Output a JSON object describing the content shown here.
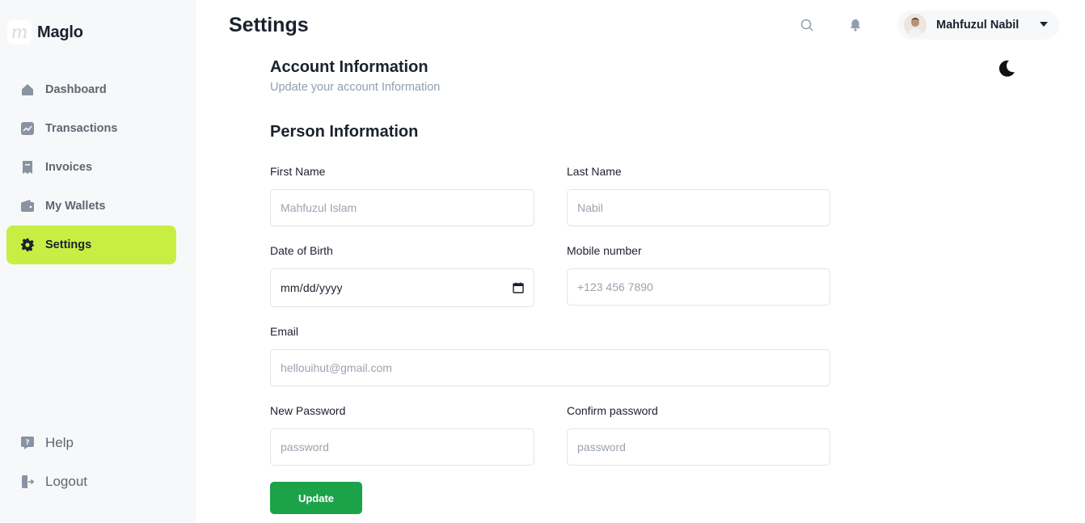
{
  "brand": {
    "logo_letter": "m",
    "name": "Maglo"
  },
  "sidebar": {
    "items": [
      {
        "label": "Dashboard",
        "icon": "home-icon"
      },
      {
        "label": "Transactions",
        "icon": "chart-icon"
      },
      {
        "label": "Invoices",
        "icon": "receipt-icon"
      },
      {
        "label": "My Wallets",
        "icon": "wallet-icon"
      },
      {
        "label": "Settings",
        "icon": "gear-icon",
        "active": true
      }
    ],
    "bottom": [
      {
        "label": "Help",
        "icon": "help-icon"
      },
      {
        "label": "Logout",
        "icon": "logout-icon"
      }
    ]
  },
  "header": {
    "title": "Settings",
    "user_name": "Mahfuzul Nabil"
  },
  "account": {
    "title": "Account Information",
    "subtitle": "Update your account Information"
  },
  "person": {
    "title": "Person Information",
    "first_name": {
      "label": "First Name",
      "placeholder": "Mahfuzul Islam"
    },
    "last_name": {
      "label": "Last Name",
      "placeholder": "Nabil"
    },
    "dob": {
      "label": "Date of Birth",
      "placeholder": "mm/dd/yyyy"
    },
    "mobile": {
      "label": "Mobile number",
      "placeholder": "+123 456 7890"
    },
    "email": {
      "label": "Email",
      "placeholder": "hellouihut@gmail.com"
    },
    "new_password": {
      "label": "New Password",
      "placeholder": "password"
    },
    "confirm_password": {
      "label": "Confirm password",
      "placeholder": "password"
    },
    "submit_label": "Update"
  },
  "colors": {
    "accent": "#c8ee44",
    "primary": "#1ca34a",
    "sidebar_bg": "#f7f8f9",
    "muted": "#929eae"
  }
}
